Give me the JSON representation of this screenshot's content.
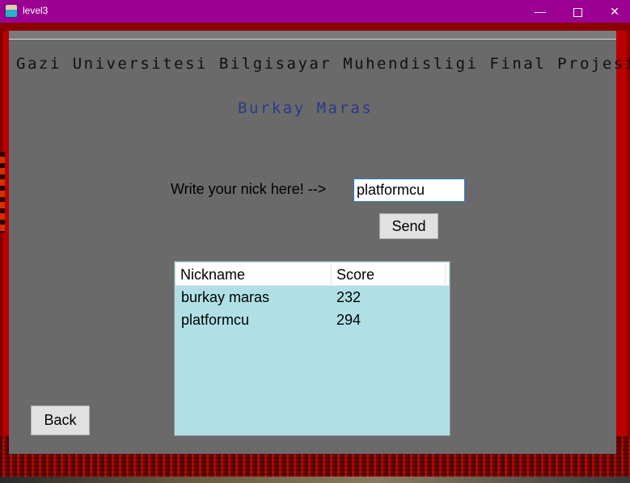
{
  "window": {
    "title": "level3",
    "minimize": "—",
    "close": "✕"
  },
  "header": {
    "title": "Gazi Universitesi Bilgisayar Muhendisligi Final Projesi",
    "author": "Burkay Maras"
  },
  "form": {
    "nick_label": "Write your nick here! -->",
    "nick_value": "platformcu",
    "send_label": "Send"
  },
  "table": {
    "columns": [
      "Nickname",
      "Score"
    ],
    "rows": [
      {
        "nickname": "burkay maras",
        "score": "232"
      },
      {
        "nickname": "platformcu",
        "score": "294"
      }
    ]
  },
  "nav": {
    "back_label": "Back"
  },
  "colors": {
    "titlebar": "#9c0092",
    "panel": "#6a6a6a",
    "table_bg": "#b0e0e6",
    "author_text": "#2a3a8a"
  },
  "icons": [
    "app-icon",
    "minimize-icon",
    "maximize-icon",
    "close-icon"
  ]
}
